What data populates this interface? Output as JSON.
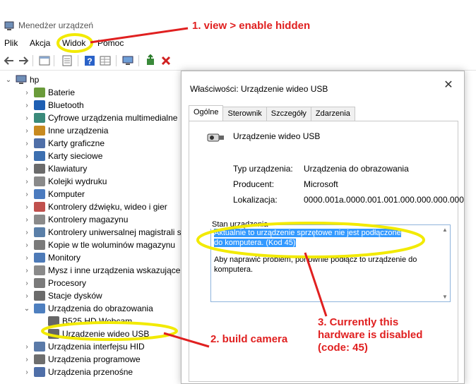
{
  "window": {
    "title": "Menedżer urządzeń"
  },
  "menu": [
    "Plik",
    "Akcja",
    "Widok",
    "Pomoc"
  ],
  "tree": {
    "root": "hp",
    "items": [
      {
        "label": "Baterie",
        "expanded": false
      },
      {
        "label": "Bluetooth",
        "expanded": false
      },
      {
        "label": "Cyfrowe urządzenia multimedialne",
        "expanded": false
      },
      {
        "label": "Inne urządzenia",
        "expanded": false
      },
      {
        "label": "Karty graficzne",
        "expanded": false
      },
      {
        "label": "Karty sieciowe",
        "expanded": false
      },
      {
        "label": "Klawiatury",
        "expanded": false
      },
      {
        "label": "Kolejki wydruku",
        "expanded": false
      },
      {
        "label": "Komputer",
        "expanded": false
      },
      {
        "label": "Kontrolery dźwięku, wideo i gier",
        "expanded": false
      },
      {
        "label": "Kontrolery magazynu",
        "expanded": false
      },
      {
        "label": "Kontrolery uniwersalnej magistrali sz",
        "expanded": false
      },
      {
        "label": "Kopie w tle woluminów magazynu",
        "expanded": false
      },
      {
        "label": "Monitory",
        "expanded": false
      },
      {
        "label": "Mysz i inne urządzenia wskazujące",
        "expanded": false
      },
      {
        "label": "Procesory",
        "expanded": false
      },
      {
        "label": "Stacje dysków",
        "expanded": false
      },
      {
        "label": "Urządzenia do obrazowania",
        "expanded": true
      },
      {
        "label": "B525 HD Webcam",
        "child": true
      },
      {
        "label": "Urządzenie wideo USB",
        "child": true
      },
      {
        "label": "Urządzenia interfejsu HID",
        "expanded": false
      },
      {
        "label": "Urządzenia programowe",
        "expanded": false
      },
      {
        "label": "Urządzenia przenośne",
        "expanded": false
      }
    ]
  },
  "dialog": {
    "title": "Właściwości: Urządzenie wideo USB",
    "close": "✕",
    "tabs": [
      "Ogólne",
      "Sterownik",
      "Szczegóły",
      "Zdarzenia"
    ],
    "device_name": "Urządzenie wideo USB",
    "props": [
      {
        "label": "Typ urządzenia:",
        "value": "Urządzenia do obrazowania"
      },
      {
        "label": "Producent:",
        "value": "Microsoft"
      },
      {
        "label": "Lokalizacja:",
        "value": "0000.001a.0000.001.001.000.000.000.000"
      }
    ],
    "status_group": "Stan urządzenia",
    "status_selected": "Aktualnie to urządzenie sprzętowe nie jest podłączone do komputera. (Kod 45)",
    "status_help": "Aby naprawić problem, ponownie podłącz to urządzenie do komputera."
  },
  "annotations": {
    "a1": "1. view > enable hidden",
    "a2": "2. build camera",
    "a3_line1": "3. Currently this",
    "a3_line2": "hardware is disabled",
    "a3_line3": "(code: 45)",
    "color": "#e02020",
    "highlight": "#f2ea00"
  }
}
